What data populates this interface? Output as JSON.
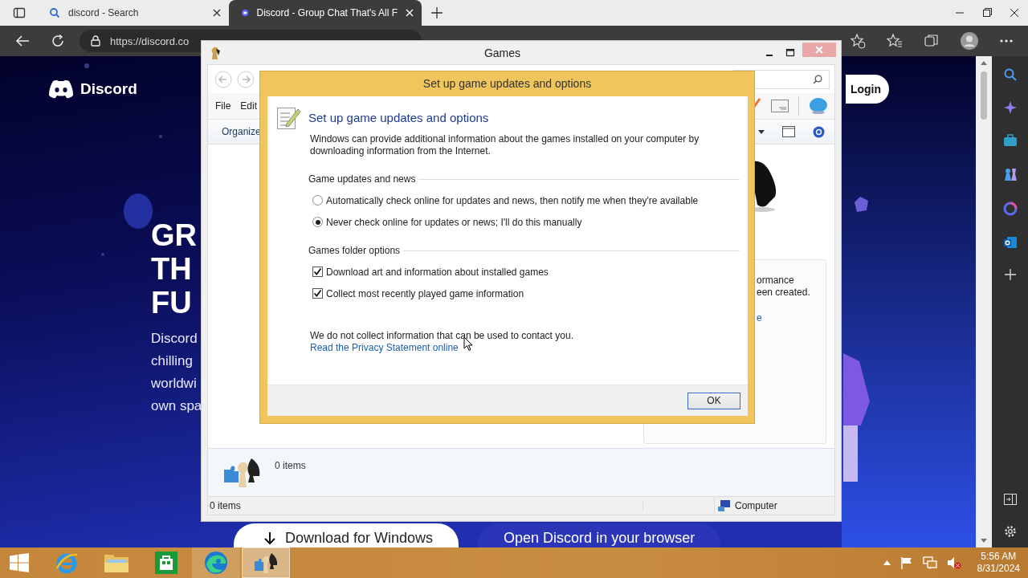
{
  "browser": {
    "tabs": [
      {
        "kind": "search",
        "title": "discord - Search",
        "selected": false
      },
      {
        "kind": "discord",
        "title": "Discord - Group Chat That's All F",
        "selected": true
      }
    ],
    "address": "https://discord.co"
  },
  "page": {
    "logo": "Discord",
    "login": "Login",
    "headline": [
      "GR",
      "TH",
      "FU"
    ],
    "body": [
      "Discord",
      "chilling",
      "worldwi",
      "own spa"
    ],
    "buttons": [
      {
        "kind": "download",
        "label": "Download for Windows"
      },
      {
        "kind": "open",
        "label": "Open Discord in your browser"
      }
    ]
  },
  "games_window": {
    "title": "Games",
    "menu": [
      "File",
      "Edit"
    ],
    "command": "Organize",
    "panel_lines": [
      "ormance",
      "een created."
    ],
    "panel_link": "e",
    "details_count": "0 items",
    "status_count": "0 items",
    "status_location": "Computer"
  },
  "dialog": {
    "title": "Set up game updates and options",
    "heading": "Set up game updates and options",
    "intro": "Windows can provide additional information about the games installed on your computer by downloading information from the Internet.",
    "groups": [
      {
        "label": "Game updates and news",
        "options": [
          {
            "kind": "radio",
            "label": "Automatically check online for updates and news, then notify me when they're available",
            "checked": false
          },
          {
            "kind": "radio",
            "label": "Never check online for updates or news; I'll do this manually",
            "checked": true
          }
        ]
      },
      {
        "label": "Games folder options",
        "options": [
          {
            "kind": "checkbox",
            "label": "Download art and information about installed games",
            "checked": true
          },
          {
            "kind": "checkbox",
            "label": "Collect most recently played game information",
            "checked": true
          }
        ]
      }
    ],
    "note": "We do not collect information that can be used to contact you.",
    "link": "Read the Privacy Statement online",
    "ok": "OK"
  },
  "taskbar": {
    "apps": [
      {
        "kind": "ie",
        "running": false,
        "selected": false
      },
      {
        "kind": "explorer",
        "running": false,
        "selected": false
      },
      {
        "kind": "store",
        "running": false,
        "selected": false
      },
      {
        "kind": "edge",
        "running": true,
        "selected": false
      },
      {
        "kind": "games",
        "running": true,
        "selected": true
      }
    ],
    "time": "5:56 AM",
    "date": "8/31/2024"
  }
}
